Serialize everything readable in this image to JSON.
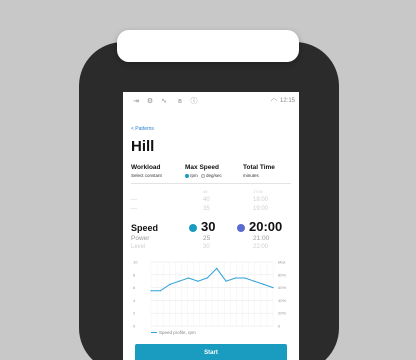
{
  "status_bar": {
    "icons": [
      "import-icon",
      "gear-icon",
      "heartbeat-icon",
      "bluetooth-icon",
      "info-icon"
    ],
    "wifi_icon": "wifi-icon",
    "time": "12:15"
  },
  "back_label": "< Patterns",
  "title": "Hill",
  "columns": {
    "workload": {
      "label": "Workload",
      "sub": "Select constant"
    },
    "max_speed": {
      "label": "Max Speed",
      "opt1": "rpm",
      "opt2": "deg/sec"
    },
    "total_time": {
      "label": "Total Time",
      "sub": "minutes"
    }
  },
  "picker": {
    "mode_above_2": "—",
    "mode_above_1": "—",
    "mode_selected": "Speed",
    "mode_below_1": "Power",
    "mode_below_2": "Level",
    "speed_top": "40",
    "speed_above_2": "40",
    "speed_above_1": "35",
    "speed_selected": "30",
    "speed_below_1": "25",
    "speed_below_2": "30",
    "time_top": "17:00",
    "time_above_2": "18:00",
    "time_above_1": "19:00",
    "time_selected": "20:00",
    "time_below_1": "21:00",
    "time_below_2": "22:00"
  },
  "chart_data": {
    "type": "line",
    "x": [
      0,
      1,
      2,
      3,
      4,
      5,
      6,
      7,
      8,
      9,
      10,
      11,
      12,
      13
    ],
    "series": [
      {
        "name": "Speed profile, rpm",
        "values": [
          5.5,
          5.5,
          6.5,
          7,
          7.5,
          7,
          7.5,
          9,
          7,
          7.5,
          7.5,
          7,
          6.5,
          6
        ]
      }
    ],
    "y_left_ticks": [
      "10",
      "8",
      "6",
      "4",
      "2",
      "0"
    ],
    "y_right_ticks": [
      "Max",
      "80%",
      "60%",
      "40%",
      "20%",
      "0"
    ],
    "ylim": [
      0,
      10
    ],
    "grid": true,
    "legend_position": "bottom-left",
    "line_color": "#2aa0d8"
  },
  "start_label": "Start",
  "colors": {
    "accent": "#1a9cc0",
    "link": "#2a7fd4",
    "device": "#2b2b2b"
  }
}
